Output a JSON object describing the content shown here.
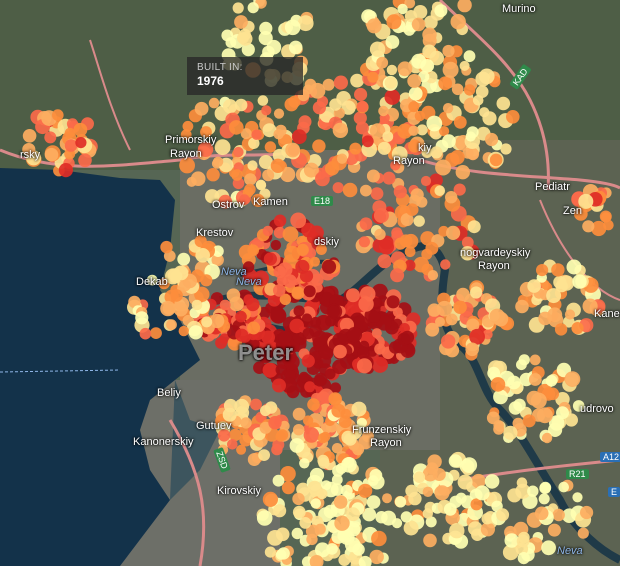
{
  "tooltip": {
    "label": "BUILT IN:",
    "value": "1976"
  },
  "labels": [
    {
      "id": "murino",
      "text": "Murino"
    },
    {
      "id": "primorskiy",
      "text": "Primorskiy"
    },
    {
      "id": "rayon-1",
      "text": "Rayon"
    },
    {
      "id": "rsky",
      "text": "rsky"
    },
    {
      "id": "kiy-rayon",
      "text": "kiy"
    },
    {
      "id": "rayon-2",
      "text": "Rayon"
    },
    {
      "id": "ostrov",
      "text": "Ostrov"
    },
    {
      "id": "kamen",
      "text": "Kamen"
    },
    {
      "id": "krestov",
      "text": "Krestov"
    },
    {
      "id": "dskiy",
      "text": "dskiy"
    },
    {
      "id": "krasnogvardeyskiy",
      "text": "nogvardeyskiy"
    },
    {
      "id": "rayon-3",
      "text": "Rayon"
    },
    {
      "id": "pediatr",
      "text": "Pediatr"
    },
    {
      "id": "zen",
      "text": "Zen"
    },
    {
      "id": "kanev",
      "text": "Kanev"
    },
    {
      "id": "dekab",
      "text": "Dekab"
    },
    {
      "id": "neva-1",
      "text": "Neva"
    },
    {
      "id": "neva-2",
      "text": "Neva"
    },
    {
      "id": "beliy",
      "text": "Beliy"
    },
    {
      "id": "gutuev",
      "text": "Gutuev"
    },
    {
      "id": "kanonerskiy",
      "text": "Kanonerskiy"
    },
    {
      "id": "frunzenskiy",
      "text": "Frunzenskiy"
    },
    {
      "id": "rayon-4",
      "text": "Rayon"
    },
    {
      "id": "rudrovo",
      "text": "udrovo"
    },
    {
      "id": "kirovskiy",
      "text": "Kirovskiy"
    },
    {
      "id": "neva-3",
      "text": "Neva"
    },
    {
      "id": "peterburg",
      "text": "Peter"
    }
  ],
  "shields": [
    {
      "id": "kad",
      "text": "KAD"
    },
    {
      "id": "e18",
      "text": "E18"
    },
    {
      "id": "r21",
      "text": "R21"
    },
    {
      "id": "a12",
      "text": "A12"
    },
    {
      "id": "zsd",
      "text": "ZSD"
    },
    {
      "id": "num-e",
      "text": "E"
    }
  ],
  "legend_colors": {
    "oldest": "#a50f15",
    "old": "#de2d26",
    "mid": "#fb6a4a",
    "newer": "#fd8d3c",
    "new": "#fdae61",
    "newest": "#fee391",
    "palest": "#ffffb2"
  }
}
